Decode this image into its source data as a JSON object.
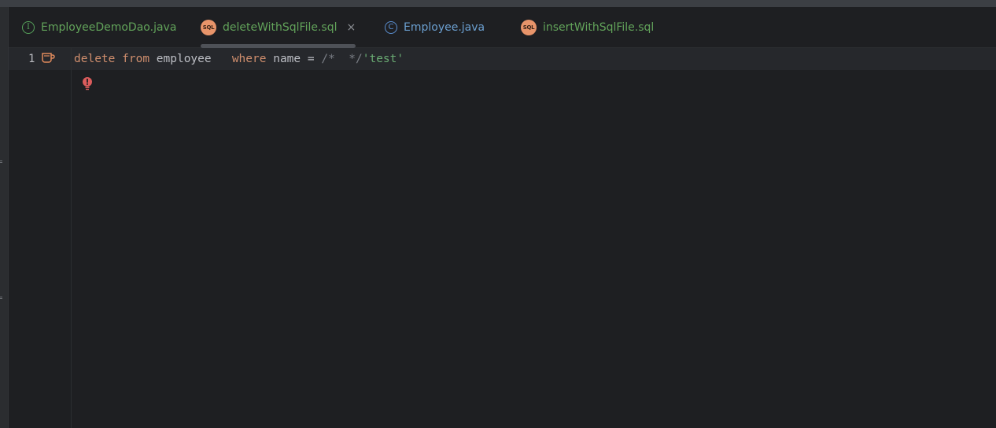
{
  "tabs": [
    {
      "label": "EmployeeDemoDao.java",
      "icon": "interface-icon",
      "icon_glyph": "I"
    },
    {
      "label": "deleteWithSqlFile.sql",
      "icon": "sql-icon",
      "icon_glyph": "SQL",
      "close_glyph": "×",
      "active": true
    },
    {
      "label": "Employee.java",
      "icon": "class-icon",
      "icon_glyph": "C"
    },
    {
      "label": "insertWithSqlFile.sql",
      "icon": "sql-icon",
      "icon_glyph": "SQL"
    }
  ],
  "editor": {
    "line_number": "1",
    "code": {
      "kw_delete": "delete",
      "kw_from": "from",
      "table": "employee",
      "kw_where": "where",
      "column": "name",
      "op": "=",
      "comment": "/*  */",
      "literal": "'test'"
    }
  },
  "colors": {
    "background": "#1e1f22",
    "keyword": "#cf8e6d",
    "identifier": "#bcbec4",
    "comment": "#7a7e85",
    "string": "#6aab73",
    "error": "#db5c5c"
  }
}
